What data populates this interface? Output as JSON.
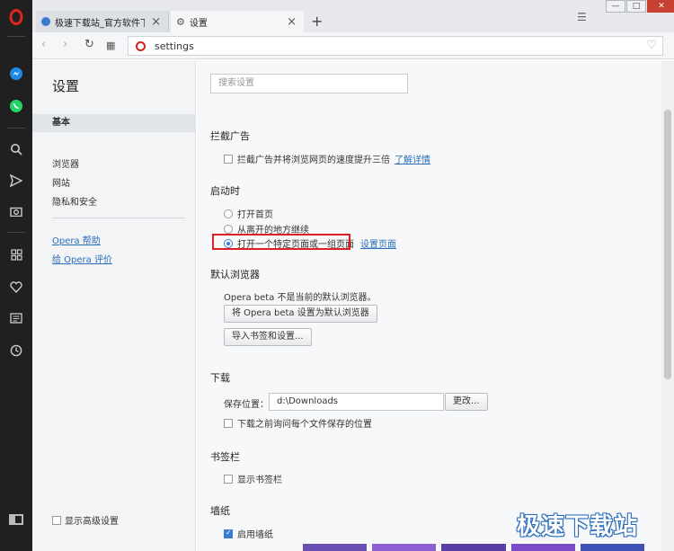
{
  "browser": {
    "tabs": [
      {
        "label": "极速下载站_官方软件下载",
        "active": false
      },
      {
        "label": "设置",
        "active": true
      }
    ],
    "new_tab": "+",
    "url": "settings"
  },
  "sidebar_icons": [
    "opera-icon",
    "messenger-icon",
    "whatsapp-icon",
    "search-icon",
    "send-icon",
    "camera-icon",
    "speed-dial-icon",
    "heart-icon",
    "news-icon",
    "history-icon"
  ],
  "nav": {
    "title": "设置",
    "items": [
      "基本",
      "浏览器",
      "网站",
      "隐私和安全"
    ],
    "links": [
      "Opera 帮助",
      "给 Opera 评价"
    ],
    "show_advanced": "显示高级设置"
  },
  "content": {
    "search_placeholder": "搜索设置",
    "adblock": {
      "title": "拦截广告",
      "option": "拦截广告并将浏览网页的速度提升三倍",
      "link": "了解详情"
    },
    "startup": {
      "title": "启动时",
      "options": [
        "打开首页",
        "从离开的地方继续",
        "打开一个特定页面或一组页面"
      ],
      "selected": 2,
      "link": "设置页面"
    },
    "default_browser": {
      "title": "默认浏览器",
      "status": "Opera beta 不是当前的默认浏览器。",
      "set_button": "将 Opera beta 设置为默认浏览器",
      "import_button": "导入书签和设置..."
    },
    "download": {
      "title": "下载",
      "save_label": "保存位置：",
      "path": "d:\\Downloads",
      "change_button": "更改...",
      "ask_option": "下载之前询问每个文件保存的位置"
    },
    "bookmarks_bar": {
      "title": "书签栏",
      "option": "显示书签栏"
    },
    "wallpaper": {
      "title": "墙纸",
      "option": "启用墙纸",
      "checked": true
    }
  },
  "watermark": "极速下载站",
  "colors": {
    "sidepanel": "#202020",
    "opera_red": "#d0211c",
    "link": "#2a6ebb",
    "highlight_box": "#e02020"
  }
}
